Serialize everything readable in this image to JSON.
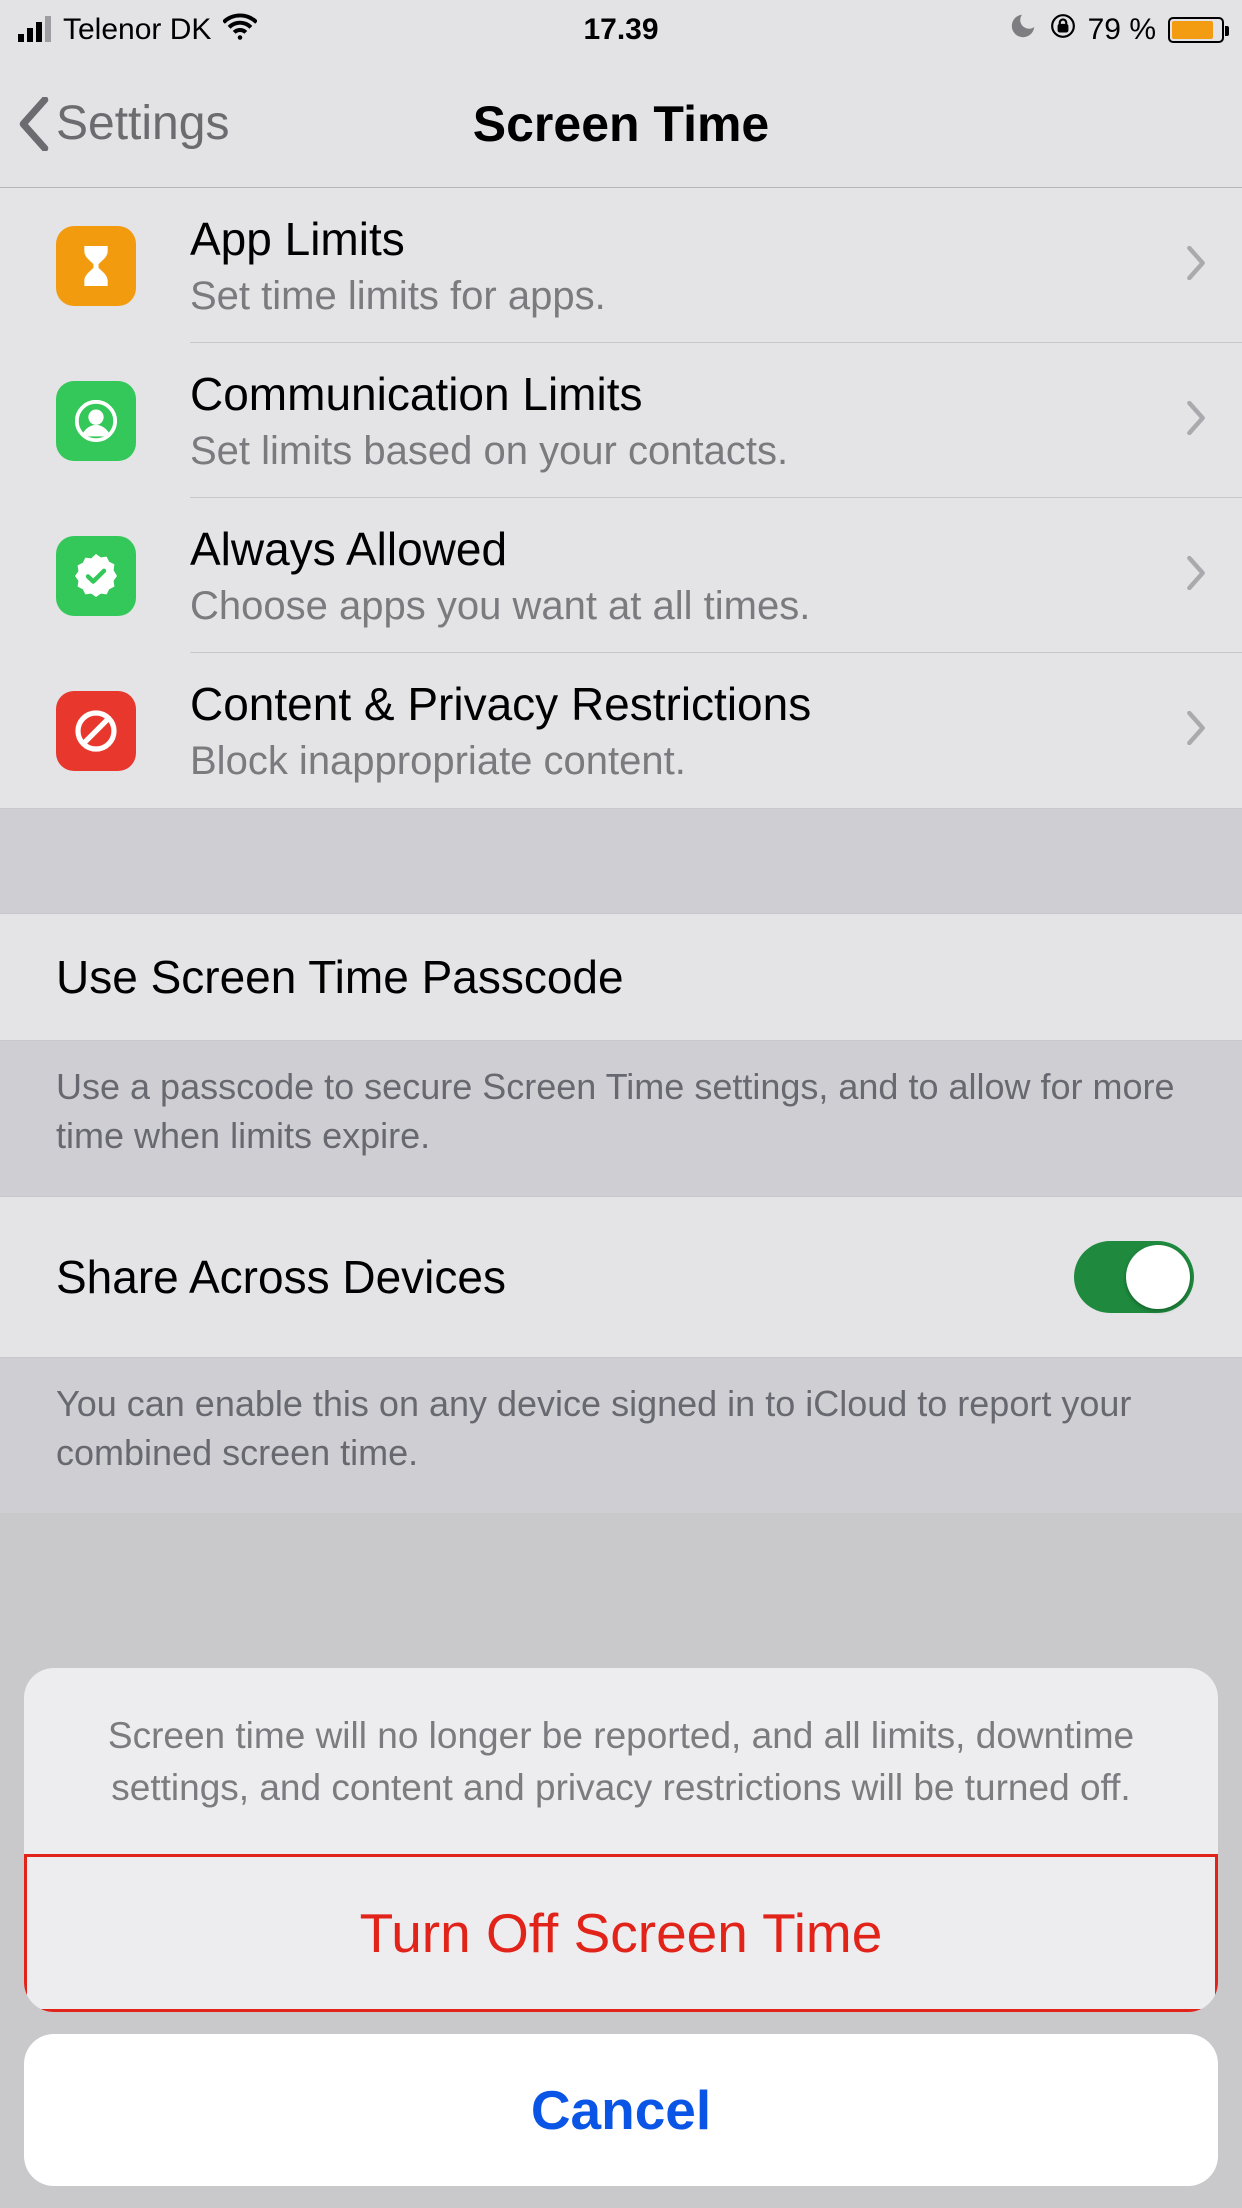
{
  "status_bar": {
    "carrier": "Telenor DK",
    "time": "17.39",
    "battery_pct": "79 %"
  },
  "nav": {
    "back_label": "Settings",
    "title": "Screen Time"
  },
  "rows": {
    "app_limits": {
      "title": "App Limits",
      "sub": "Set time limits for apps."
    },
    "comm_limits": {
      "title": "Communication Limits",
      "sub": "Set limits based on your contacts."
    },
    "always": {
      "title": "Always Allowed",
      "sub": "Choose apps you want at all times."
    },
    "content": {
      "title": "Content & Privacy Restrictions",
      "sub": "Block inappropriate content."
    }
  },
  "passcode": {
    "link": "Use Screen Time Passcode",
    "footer": "Use a passcode to secure Screen Time settings, and to allow for more time when limits expire."
  },
  "share": {
    "title": "Share Across Devices",
    "footer": "You can enable this on any device signed in to iCloud to report your combined screen time.",
    "on": true
  },
  "sheet": {
    "message": "Screen time will no longer be reported, and all limits, downtime settings, and content and privacy restrictions will be turned off.",
    "destructive": "Turn Off Screen Time",
    "cancel": "Cancel"
  }
}
